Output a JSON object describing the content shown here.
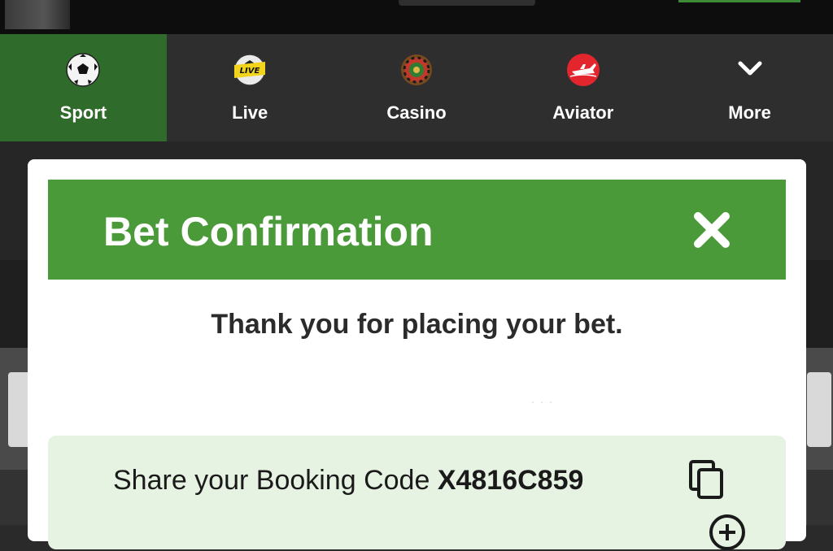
{
  "nav": {
    "items": [
      {
        "label": "Sport",
        "icon": "soccer-ball-icon",
        "active": true
      },
      {
        "label": "Live",
        "icon": "live-ball-icon",
        "active": false
      },
      {
        "label": "Casino",
        "icon": "roulette-icon",
        "active": false
      },
      {
        "label": "Aviator",
        "icon": "aviator-plane-icon",
        "active": false
      },
      {
        "label": "More",
        "icon": "chevron-down-icon",
        "active": false
      }
    ]
  },
  "modal": {
    "title": "Bet Confirmation",
    "message": "Thank you for placing your bet.",
    "booking": {
      "prefix": "Share your Booking Code ",
      "code": "X4816C859"
    }
  },
  "colors": {
    "nav_active": "#2f6b2a",
    "header_green": "#4a9a3a",
    "booking_bg": "#e6f3e2"
  }
}
